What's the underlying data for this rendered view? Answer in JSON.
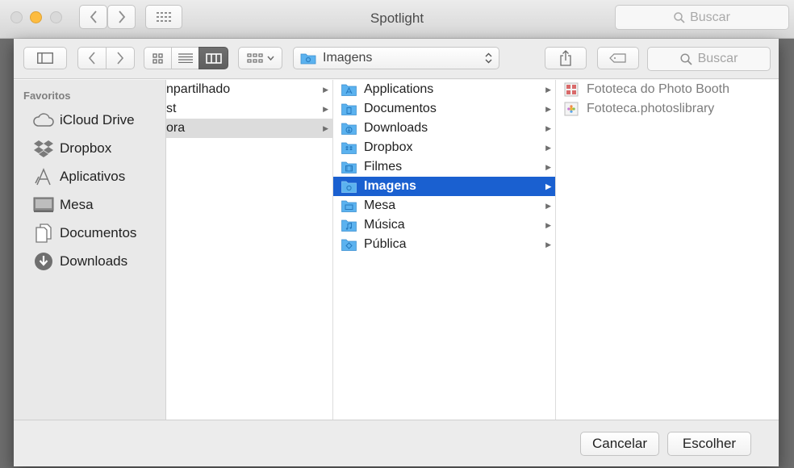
{
  "window": {
    "title": "Spotlight",
    "search_placeholder": "Buscar"
  },
  "toolbar": {
    "path_label": "Imagens",
    "search_placeholder": "Buscar"
  },
  "sidebar": {
    "heading": "Favoritos",
    "items": [
      {
        "label": "iCloud Drive",
        "icon": "cloud-icon"
      },
      {
        "label": "Dropbox",
        "icon": "dropbox-icon"
      },
      {
        "label": "Aplicativos",
        "icon": "applications-icon"
      },
      {
        "label": "Mesa",
        "icon": "desktop-icon"
      },
      {
        "label": "Documentos",
        "icon": "documents-icon"
      },
      {
        "label": "Downloads",
        "icon": "downloads-icon"
      }
    ]
  },
  "column1": {
    "items": [
      {
        "label": "npartilhado",
        "selected": false
      },
      {
        "label": "st",
        "selected": false
      },
      {
        "label": "ora",
        "selected": true
      }
    ]
  },
  "column2": {
    "items": [
      {
        "label": "Applications",
        "icon": "applications-folder-icon"
      },
      {
        "label": "Documentos",
        "icon": "documents-folder-icon"
      },
      {
        "label": "Downloads",
        "icon": "downloads-folder-icon"
      },
      {
        "label": "Dropbox",
        "icon": "dropbox-folder-icon"
      },
      {
        "label": "Filmes",
        "icon": "movies-folder-icon"
      },
      {
        "label": "Imagens",
        "icon": "pictures-folder-icon",
        "selected": true
      },
      {
        "label": "Mesa",
        "icon": "desktop-folder-icon"
      },
      {
        "label": "Música",
        "icon": "music-folder-icon"
      },
      {
        "label": "Pública",
        "icon": "public-folder-icon"
      }
    ]
  },
  "column3": {
    "items": [
      {
        "label": "Fototeca do Photo Booth",
        "icon": "photo-booth-library-icon"
      },
      {
        "label": "Fototeca.photoslibrary",
        "icon": "photos-library-icon"
      }
    ]
  },
  "footer": {
    "cancel_label": "Cancelar",
    "choose_label": "Escolher"
  },
  "colors": {
    "selection_blue": "#1a60d0",
    "folder_blue": "#5bb2ef",
    "minimize_yellow": "#fdbc40"
  }
}
